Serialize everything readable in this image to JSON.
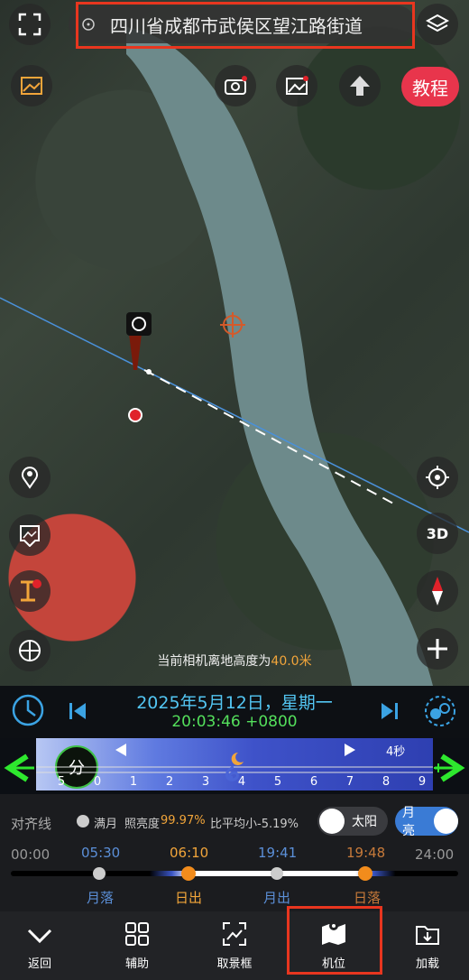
{
  "search": {
    "address": "四川省成都市武侯区望江路街道"
  },
  "map": {
    "tutorial_label": "教程",
    "altitude_prefix": "当前相机离地高度为",
    "altitude_value": "40.0米",
    "btn_3d": "3D"
  },
  "datetime": {
    "date": "2025年5月12日，星期一",
    "time": "20:03:46 +0800"
  },
  "timeline": {
    "mode_label": "分",
    "speed": "4秒",
    "ticks": [
      "5",
      "0",
      "1",
      "2",
      "3",
      "4",
      "5",
      "6",
      "7",
      "8",
      "9"
    ]
  },
  "info": {
    "align_label": "对齐线",
    "moon_phase": "满月",
    "illum_label": "照亮度",
    "illum_value": "99.97%",
    "size_note": "比平均小-5.19%",
    "sun_toggle": "太阳",
    "moon_toggle": "月亮",
    "start_time": "00:00",
    "end_time": "24:00",
    "events": [
      {
        "time": "05:30",
        "label": "月落",
        "color": "#5b8fd8"
      },
      {
        "time": "06:10",
        "label": "日出",
        "color": "#f2a53a"
      },
      {
        "time": "19:41",
        "label": "月出",
        "color": "#5b8fd8"
      },
      {
        "time": "19:48",
        "label": "日落",
        "color": "#c77a3a"
      }
    ]
  },
  "tabs": [
    {
      "label": "返回",
      "icon": "chevron-down-icon"
    },
    {
      "label": "辅助",
      "icon": "grid-icon"
    },
    {
      "label": "取景框",
      "icon": "viewfinder-icon"
    },
    {
      "label": "机位",
      "icon": "map-pin-icon"
    },
    {
      "label": "加载",
      "icon": "folder-download-icon"
    }
  ]
}
